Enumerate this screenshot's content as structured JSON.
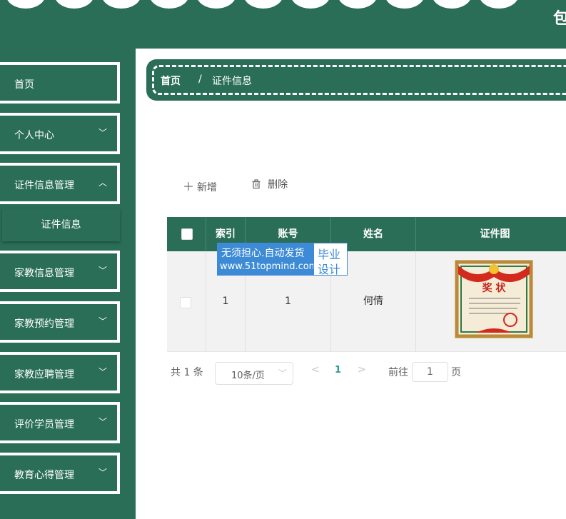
{
  "header": {
    "title_fragment": "包"
  },
  "sidebar": {
    "items": [
      {
        "label": "首页"
      },
      {
        "label": "个人中心",
        "chevron": "chevron-down-icon"
      },
      {
        "label": "证件信息管理",
        "chevron": "chevron-down-icon",
        "expanded": true
      },
      {
        "label": "家教信息管理",
        "chevron": "chevron-down-icon"
      },
      {
        "label": "家教预约管理",
        "chevron": "chevron-down-icon"
      },
      {
        "label": "家教应聘管理",
        "chevron": "chevron-down-icon"
      },
      {
        "label": "评价学员管理",
        "chevron": "chevron-down-icon"
      },
      {
        "label": "教育心得管理",
        "chevron": "chevron-down-icon"
      }
    ],
    "subitem": {
      "label": "证件信息"
    }
  },
  "breadcrumb": {
    "home": "首页",
    "separator": "/",
    "current": "证件信息"
  },
  "toolbar": {
    "add_label": "新增",
    "delete_label": "删除"
  },
  "table": {
    "headers": [
      "索引",
      "账号",
      "姓名",
      "证件图"
    ],
    "rows": [
      {
        "index": "1",
        "account": "1",
        "name": "何倩",
        "image": "award-certificate-image"
      }
    ]
  },
  "watermark": {
    "line1": "无须担心.自动发货",
    "line2": "www.51topmind.com",
    "right1": "毕业",
    "right2": "设计"
  },
  "pagination": {
    "total_text": "共 1 条",
    "page_size": "10条/页",
    "current_page": "1",
    "goto_label": "前往",
    "goto_value": "1",
    "page_suffix": "页"
  },
  "colors": {
    "primary": "#2a6e57",
    "watermark": "#3d8bd6",
    "accent_page": "#2a9d8f"
  },
  "certificate": {
    "title": "奖 状"
  }
}
